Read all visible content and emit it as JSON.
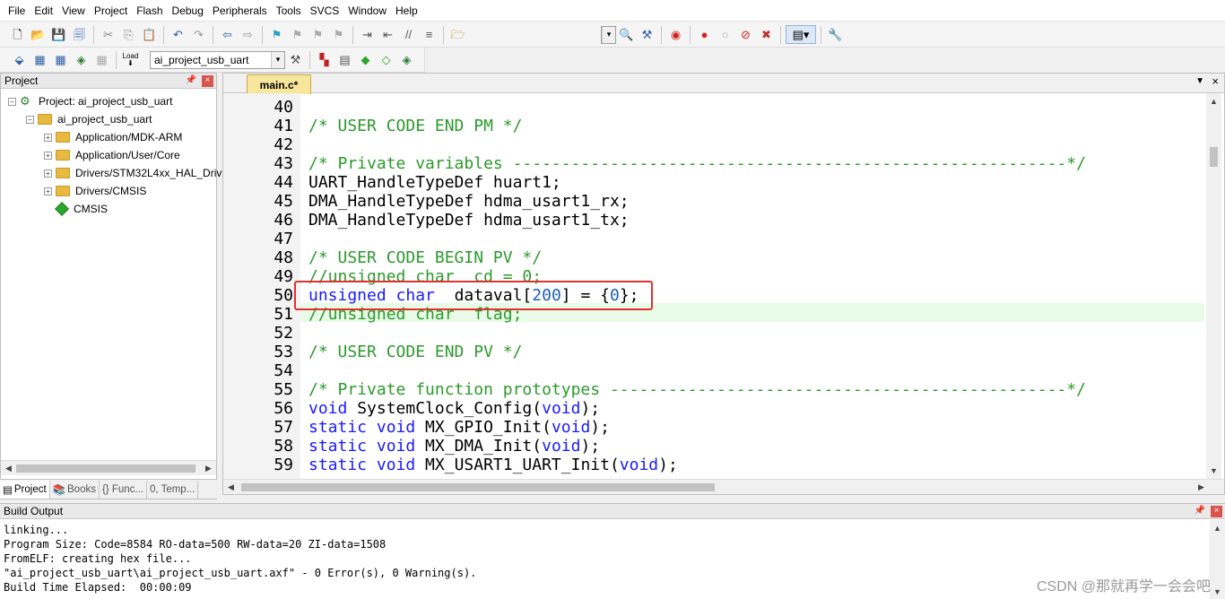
{
  "menu": [
    "File",
    "Edit",
    "View",
    "Project",
    "Flash",
    "Debug",
    "Peripherals",
    "Tools",
    "SVCS",
    "Window",
    "Help"
  ],
  "toolbar2": {
    "target_combo": "ai_project_usb_uart",
    "load_label": "Load"
  },
  "project_panel": {
    "title": "Project",
    "tree": [
      {
        "label": "Project: ai_project_usb_uart",
        "icon": "project-icon",
        "expander": "−"
      },
      {
        "label": "ai_project_usb_uart",
        "icon": "folder-icon",
        "expander": "−"
      },
      {
        "label": "Application/MDK-ARM",
        "icon": "folder-icon",
        "expander": "+"
      },
      {
        "label": "Application/User/Core",
        "icon": "folder-icon",
        "expander": "+"
      },
      {
        "label": "Drivers/STM32L4xx_HAL_Driv",
        "icon": "folder-icon",
        "expander": "+"
      },
      {
        "label": "Drivers/CMSIS",
        "icon": "folder-icon",
        "expander": "+"
      },
      {
        "label": "CMSIS",
        "icon": "cmsis-diamond-icon",
        "expander": ""
      }
    ],
    "tabs": [
      "Project",
      "Books",
      "{} Func...",
      "0, Temp..."
    ]
  },
  "editor": {
    "tab": "main.c*",
    "lines": [
      {
        "n": "40",
        "segs": []
      },
      {
        "n": "41",
        "segs": [
          {
            "c": "cm",
            "t": "/* USER CODE END PM */"
          }
        ]
      },
      {
        "n": "42",
        "segs": []
      },
      {
        "n": "43",
        "segs": [
          {
            "c": "cm",
            "t": "/* Private variables ---------------------------------------------------------*/"
          }
        ]
      },
      {
        "n": "44",
        "segs": [
          {
            "c": "",
            "t": "UART_HandleTypeDef huart1;"
          }
        ]
      },
      {
        "n": "45",
        "segs": [
          {
            "c": "",
            "t": "DMA_HandleTypeDef hdma_usart1_rx;"
          }
        ]
      },
      {
        "n": "46",
        "segs": [
          {
            "c": "",
            "t": "DMA_HandleTypeDef hdma_usart1_tx;"
          }
        ]
      },
      {
        "n": "47",
        "segs": []
      },
      {
        "n": "48",
        "segs": [
          {
            "c": "cm",
            "t": "/* USER CODE BEGIN PV */"
          }
        ]
      },
      {
        "n": "49",
        "segs": [
          {
            "c": "cm",
            "t": "//unsigned char  cd = 0;"
          }
        ]
      },
      {
        "n": "50",
        "segs": [
          {
            "c": "kw",
            "t": "unsigned char"
          },
          {
            "c": "",
            "t": "  dataval["
          },
          {
            "c": "num",
            "t": "200"
          },
          {
            "c": "",
            "t": "] = {"
          },
          {
            "c": "num",
            "t": "0"
          },
          {
            "c": "",
            "t": "};"
          }
        ]
      },
      {
        "n": "51",
        "segs": [
          {
            "c": "cm",
            "t": "//unsigned char  flag;"
          }
        ]
      },
      {
        "n": "52",
        "segs": []
      },
      {
        "n": "53",
        "segs": [
          {
            "c": "cm",
            "t": "/* USER CODE END PV */"
          }
        ]
      },
      {
        "n": "54",
        "segs": []
      },
      {
        "n": "55",
        "segs": [
          {
            "c": "cm",
            "t": "/* Private function prototypes -----------------------------------------------*/"
          }
        ]
      },
      {
        "n": "56",
        "segs": [
          {
            "c": "kw",
            "t": "void"
          },
          {
            "c": "",
            "t": " SystemClock_Config("
          },
          {
            "c": "kw",
            "t": "void"
          },
          {
            "c": "",
            "t": ");"
          }
        ]
      },
      {
        "n": "57",
        "segs": [
          {
            "c": "kw",
            "t": "static void"
          },
          {
            "c": "",
            "t": " MX_GPIO_Init("
          },
          {
            "c": "kw",
            "t": "void"
          },
          {
            "c": "",
            "t": ");"
          }
        ]
      },
      {
        "n": "58",
        "segs": [
          {
            "c": "kw",
            "t": "static void"
          },
          {
            "c": "",
            "t": " MX_DMA_Init("
          },
          {
            "c": "kw",
            "t": "void"
          },
          {
            "c": "",
            "t": ");"
          }
        ]
      },
      {
        "n": "59",
        "segs": [
          {
            "c": "kw",
            "t": "static void"
          },
          {
            "c": "",
            "t": " MX_USART1_UART_Init("
          },
          {
            "c": "kw",
            "t": "void"
          },
          {
            "c": "",
            "t": ");"
          }
        ]
      }
    ]
  },
  "build_output": {
    "title": "Build Output",
    "lines": [
      "linking...",
      "Program Size: Code=8584 RO-data=500 RW-data=20 ZI-data=1508",
      "FromELF: creating hex file...",
      "\"ai_project_usb_uart\\ai_project_usb_uart.axf\" - 0 Error(s), 0 Warning(s).",
      "Build Time Elapsed:  00:00:09"
    ]
  },
  "watermark": "CSDN @那就再学一会会吧",
  "colors": {
    "comment": "#2b9a2b",
    "keyword": "#1a1aff",
    "number": "#1b5fb0",
    "highlight_line": "#e7fbe7",
    "annotation_box": "#e23030",
    "active_tab": "#f7e69b"
  }
}
